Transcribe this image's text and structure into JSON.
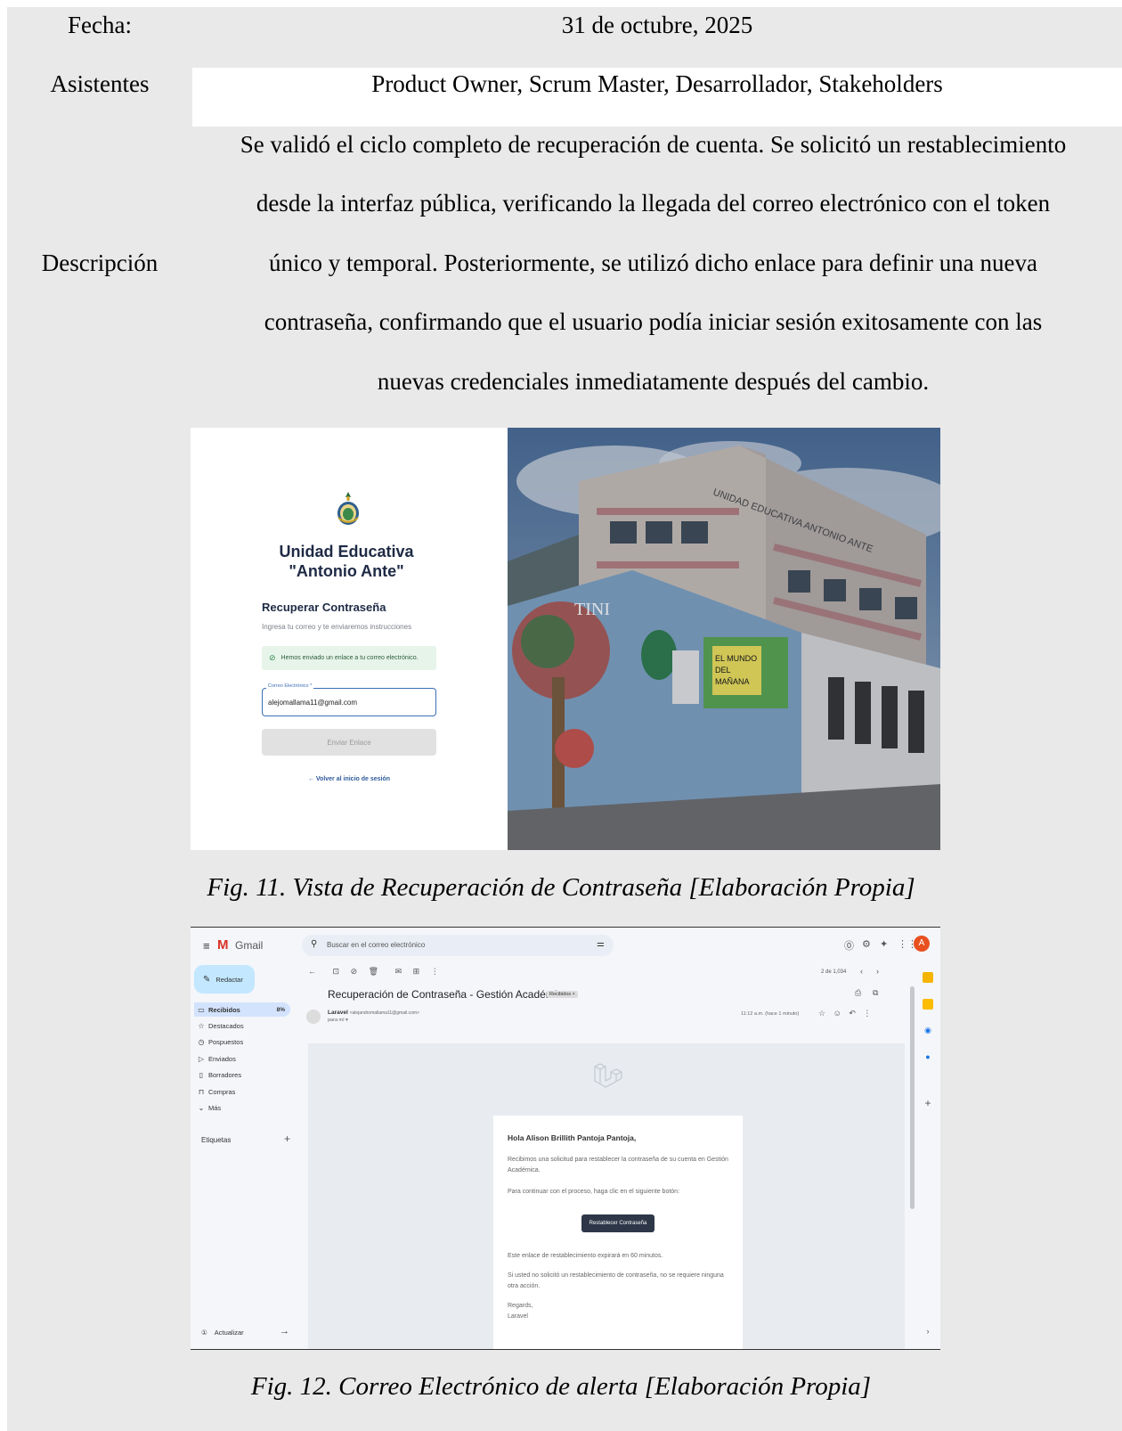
{
  "table": {
    "fecha_label": "Fecha:",
    "fecha_value": "31 de octubre, 2025",
    "asistentes_label": "Asistentes",
    "asistentes_value": "Product Owner, Scrum Master, Desarrollador, Stakeholders",
    "descripcion_label": "Descripción",
    "descripcion_lines": [
      "Se validó el ciclo completo de recuperación de cuenta. Se solicitó un restablecimiento",
      "desde la interfaz pública, verificando la llegada del correo electrónico con el token",
      "único y temporal. Posteriormente, se utilizó dicho enlace para definir una nueva",
      "contraseña, confirmando que el usuario podía iniciar sesión exitosamente con las",
      "nuevas credenciales inmediatamente después del cambio."
    ]
  },
  "fig11": {
    "school_name_1": "Unidad Educativa",
    "school_name_2": "\"Antonio Ante\"",
    "title": "Recuperar Contraseña",
    "subtitle": "Ingresa tu correo y te enviaremos instrucciones",
    "alert": "Hemos enviado un enlace a tu correo electrónico.",
    "email_label": "Correo Electrónico *",
    "email_value": "alejomallama11@gmail.com",
    "send_button": "Enviar Enlace",
    "back_link": "← Volver al inicio de sesión",
    "photo_sign": "UNIDAD EDUCATIVA ANTONIO ANTE",
    "mural_text": "TINI",
    "board_text_1": "EL MUNDO",
    "board_text_2": "DEL",
    "board_text_3": "MAÑANA",
    "caption": "Fig. 11. Vista de Recuperación de Contraseña [Elaboración Propia]"
  },
  "fig12": {
    "app_name": "Gmail",
    "search_placeholder": "Buscar en el correo electrónico",
    "compose": "Redactar",
    "nav": [
      {
        "label": "Recibidos",
        "count": "8%"
      },
      {
        "label": "Destacados"
      },
      {
        "label": "Pospuestos"
      },
      {
        "label": "Enviados"
      },
      {
        "label": "Borradores"
      },
      {
        "label": "Compras"
      },
      {
        "label": "Más"
      }
    ],
    "labels_heading": "Etiquetas",
    "update": "Actualizar",
    "pager": "2 de 1,034",
    "subject": "Recuperación de Contraseña - Gestión Académica",
    "subject_badge": "Recibidos ×",
    "sender_name": "Laravel",
    "sender_email": "<alejandromallama11@gmail.com>",
    "to_me": "para mí ▾",
    "time": "11:12 a.m. (hace 1 minuto)",
    "avatar_letter": "A",
    "greeting": "Hola Alison Brillith Pantoja Pantoja,",
    "p1": "Recibimos una solicitud para restablecer la contraseña de su cuenta en Gestión Académica.",
    "p2": "Para continuar con el proceso, haga clic en el siguiente botón:",
    "button": "Restablecer Contraseña",
    "p3": "Este enlace de restablecimiento expirará en 60 minutos.",
    "p4": "Si usted no solicitó un restablecimiento de contraseña, no se requiere ninguna otra acción.",
    "regards": "Regards,",
    "signature": "Laravel",
    "caption": "Fig. 12. Correo Electrónico de alerta [Elaboración Propia]"
  }
}
